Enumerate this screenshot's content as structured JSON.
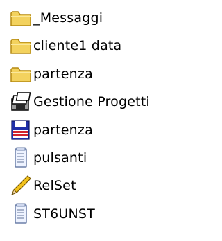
{
  "items": [
    {
      "label": "_Messaggi",
      "icon": "folder-icon"
    },
    {
      "label": "cliente1 data",
      "icon": "folder-icon"
    },
    {
      "label": "partenza",
      "icon": "folder-icon"
    },
    {
      "label": "Gestione Progetti",
      "icon": "card-index-icon"
    },
    {
      "label": "partenza",
      "icon": "floppy-disk-icon"
    },
    {
      "label": "pulsanti",
      "icon": "notepad-icon"
    },
    {
      "label": "RelSet",
      "icon": "pencil-icon"
    },
    {
      "label": "ST6UNST",
      "icon": "notepad-icon"
    }
  ],
  "colors": {
    "folder": "#F3D25E",
    "folder_outline": "#B58A12",
    "floppy_blue": "#1F2FA8",
    "floppy_red": "#D3232B",
    "pencil_yellow": "#F2C21D"
  }
}
